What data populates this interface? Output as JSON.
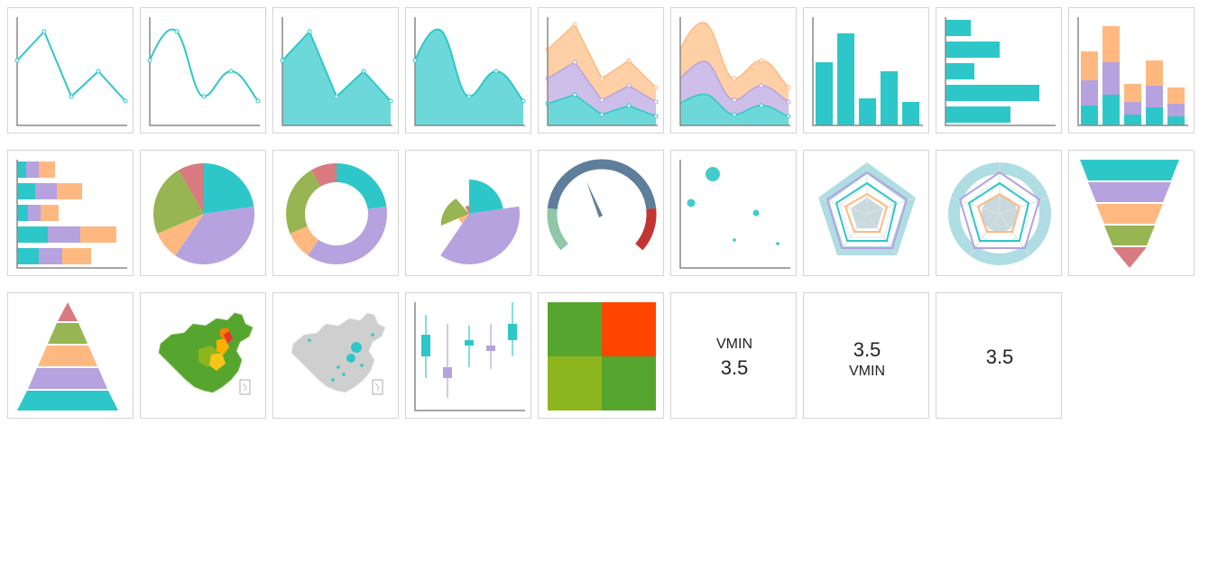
{
  "palette": {
    "teal": "#2ec7c9",
    "teal_light": "#6dd8da",
    "purple": "#b6a2de",
    "orange": "#ffb980",
    "red": "#d87a80",
    "olive": "#97b552",
    "axis": "#888888",
    "gauge_blue": "#5e7e9b",
    "gauge_green": "#8fc7a8",
    "gauge_red": "#c23531",
    "heat_green": "#56a52e",
    "heat_orange": "#ff4500",
    "heat_yellow": "#8db61e"
  },
  "thumbnails": [
    {
      "type": "line",
      "icon": "line-chart-icon"
    },
    {
      "type": "smooth-line",
      "icon": "smooth-line-chart-icon"
    },
    {
      "type": "area",
      "icon": "area-chart-icon"
    },
    {
      "type": "smooth-area",
      "icon": "smooth-area-chart-icon"
    },
    {
      "type": "stacked-area",
      "icon": "stacked-area-chart-icon"
    },
    {
      "type": "stacked-smooth-area",
      "icon": "stacked-smooth-area-chart-icon"
    },
    {
      "type": "column",
      "icon": "column-chart-icon"
    },
    {
      "type": "horizontal-bar",
      "icon": "horizontal-bar-chart-icon"
    },
    {
      "type": "stacked-column",
      "icon": "stacked-column-chart-icon"
    },
    {
      "type": "stacked-bar",
      "icon": "stacked-bar-chart-icon"
    },
    {
      "type": "pie",
      "icon": "pie-chart-icon"
    },
    {
      "type": "donut",
      "icon": "donut-chart-icon"
    },
    {
      "type": "rose",
      "icon": "rose-chart-icon"
    },
    {
      "type": "gauge",
      "icon": "gauge-chart-icon"
    },
    {
      "type": "scatter",
      "icon": "scatter-chart-icon"
    },
    {
      "type": "radar-polygon",
      "icon": "radar-polygon-chart-icon"
    },
    {
      "type": "radar-circle",
      "icon": "radar-circle-chart-icon"
    },
    {
      "type": "funnel",
      "icon": "funnel-chart-icon"
    },
    {
      "type": "pyramid",
      "icon": "pyramid-chart-icon"
    },
    {
      "type": "filled-map",
      "icon": "filled-map-icon"
    },
    {
      "type": "bubble-map",
      "icon": "bubble-map-icon"
    },
    {
      "type": "candlestick",
      "icon": "candlestick-chart-icon"
    },
    {
      "type": "heatmap",
      "icon": "heatmap-icon"
    },
    {
      "type": "kpi",
      "label": "VMIN",
      "value": "3.5",
      "label_position": "top"
    },
    {
      "type": "kpi",
      "label": "VMIN",
      "value": "3.5",
      "label_position": "bottom"
    },
    {
      "type": "kpi",
      "label": "",
      "value": "3.5",
      "label_position": "none"
    }
  ]
}
